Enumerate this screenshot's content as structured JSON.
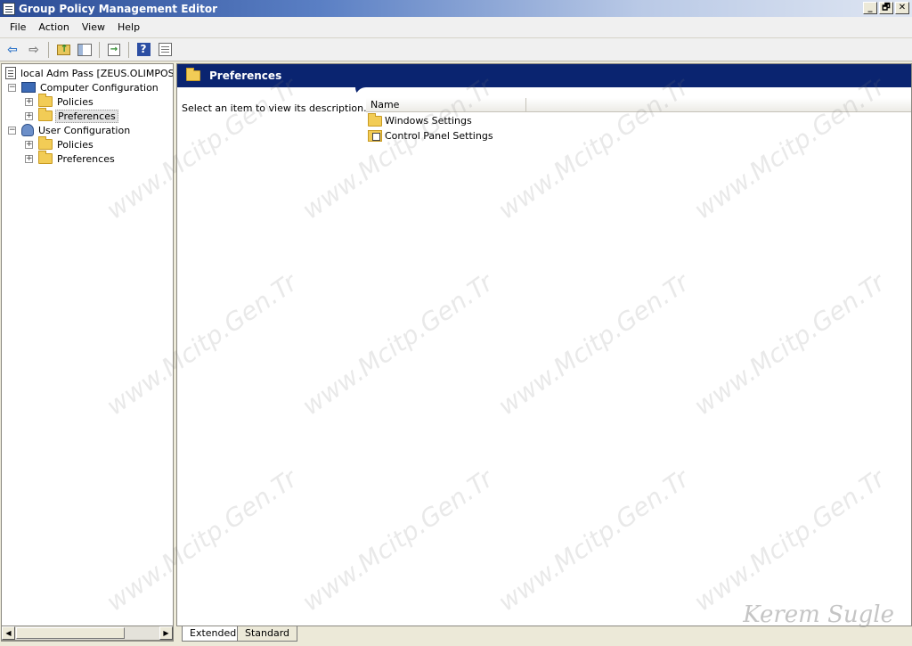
{
  "window": {
    "title": "Group Policy Management Editor"
  },
  "menu": [
    "File",
    "Action",
    "View",
    "Help"
  ],
  "window_buttons": {
    "minimize": "_",
    "restore": "🗗",
    "close": "✕"
  },
  "tree": {
    "root": "local Adm Pass [ZEUS.OLIMPOS.LC",
    "computer_config": "Computer Configuration",
    "cc_policies": "Policies",
    "cc_preferences": "Preferences",
    "user_config": "User Configuration",
    "uc_policies": "Policies",
    "uc_preferences": "Preferences"
  },
  "main": {
    "header_title": "Preferences",
    "description": "Select an item to view its description.",
    "column_name": "Name",
    "items": [
      "Windows Settings",
      "Control Panel Settings"
    ]
  },
  "tabs": [
    "Extended",
    "Standard"
  ],
  "watermark": "www.Mcitp.Gen.Tr",
  "signature": "Kerem Sugle",
  "colors": {
    "header": "#0a2470",
    "titlebar": "#2b4c95"
  },
  "icons": [
    "back-arrow-icon",
    "forward-arrow-icon",
    "folder-up-icon",
    "show-hide-pane-icon",
    "export-list-icon",
    "help-icon",
    "properties-icon"
  ]
}
